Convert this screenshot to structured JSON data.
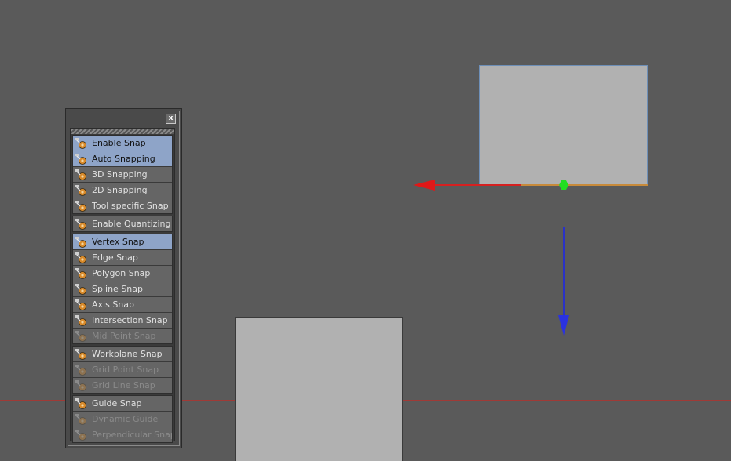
{
  "palette": {
    "close_label": "x",
    "groups": [
      {
        "items": [
          {
            "label": "Enable Snap",
            "state": "active",
            "icon": "magnet-icon"
          },
          {
            "label": "Auto Snapping",
            "state": "active",
            "icon": "auto-snap-icon"
          },
          {
            "label": "3D Snapping",
            "state": "normal",
            "icon": "3d-snap-icon"
          },
          {
            "label": "2D Snapping",
            "state": "normal",
            "icon": "2d-snap-icon"
          },
          {
            "label": "Tool specific Snap",
            "state": "normal",
            "icon": "tool-snap-icon"
          }
        ]
      },
      {
        "items": [
          {
            "label": "Enable Quantizing",
            "state": "normal",
            "icon": "quantize-icon"
          }
        ]
      },
      {
        "items": [
          {
            "label": "Vertex Snap",
            "state": "active",
            "icon": "vertex-snap-icon"
          },
          {
            "label": "Edge Snap",
            "state": "normal",
            "icon": "edge-snap-icon"
          },
          {
            "label": "Polygon Snap",
            "state": "normal",
            "icon": "polygon-snap-icon"
          },
          {
            "label": "Spline Snap",
            "state": "normal",
            "icon": "spline-snap-icon"
          },
          {
            "label": "Axis Snap",
            "state": "normal",
            "icon": "axis-snap-icon"
          },
          {
            "label": "Intersection Snap",
            "state": "normal",
            "icon": "intersection-snap-icon"
          },
          {
            "label": "Mid Point Snap",
            "state": "disabled",
            "icon": "midpoint-snap-icon"
          }
        ]
      },
      {
        "items": [
          {
            "label": "Workplane Snap",
            "state": "normal",
            "icon": "workplane-snap-icon"
          },
          {
            "label": "Grid Point Snap",
            "state": "disabled",
            "icon": "grid-point-snap-icon"
          },
          {
            "label": "Grid Line Snap",
            "state": "disabled",
            "icon": "grid-line-snap-icon"
          }
        ]
      },
      {
        "items": [
          {
            "label": "Guide Snap",
            "state": "normal",
            "icon": "guide-snap-icon"
          },
          {
            "label": "Dynamic Guide",
            "state": "disabled",
            "icon": "dynamic-guide-icon"
          },
          {
            "label": "Perpendicular Snap",
            "state": "disabled",
            "icon": "perpendicular-snap-icon"
          }
        ]
      }
    ]
  },
  "colors": {
    "viewport_bg": "#5a5a5a",
    "active_item": "#8ea4c8",
    "x_axis": "#e01818",
    "y_axis": "#2a32e0",
    "pivot": "#22dd22",
    "object_fill": "#b1b1b1"
  }
}
